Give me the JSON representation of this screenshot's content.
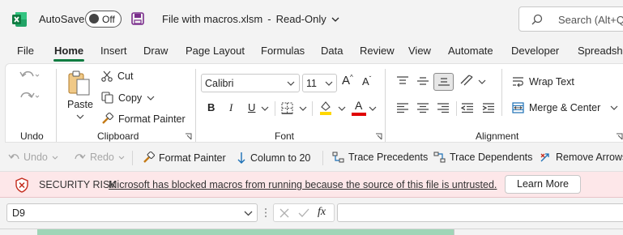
{
  "titlebar": {
    "autosave_label": "AutoSave",
    "autosave_state": "Off",
    "filename": "File with macros.xlsm",
    "separator": "-",
    "mode": "Read-Only",
    "search_placeholder": "Search (Alt+Q)"
  },
  "tabs": [
    "File",
    "Home",
    "Insert",
    "Draw",
    "Page Layout",
    "Formulas",
    "Data",
    "Review",
    "View",
    "Automate",
    "Developer",
    "Spreadsheet"
  ],
  "ribbon": {
    "undo_group": "Undo",
    "clipboard": {
      "paste": "Paste",
      "cut": "Cut",
      "copy": "Copy",
      "format_painter": "Format Painter",
      "group_label": "Clipboard"
    },
    "font": {
      "name": "Calibri",
      "size": "11",
      "grow": "A",
      "shrink": "A",
      "bold": "B",
      "italic": "I",
      "underline": "U",
      "font_color_letter": "A",
      "group_label": "Font",
      "highlight_color": "#ffd700",
      "font_color": "#e00000"
    },
    "alignment": {
      "wrap_text": "Wrap Text",
      "merge_center": "Merge & Center",
      "group_label": "Alignment"
    }
  },
  "qat": {
    "undo": "Undo",
    "redo": "Redo",
    "format_painter": "Format Painter",
    "column": "Column to 20",
    "trace_precedents": "Trace Precedents",
    "trace_dependents": "Trace Dependents",
    "remove_arrows": "Remove Arrows"
  },
  "security": {
    "title": "SECURITY RISK",
    "message": "Microsoft has blocked macros from running because the source of this file is untrusted.",
    "button": "Learn More"
  },
  "formula_bar": {
    "name_box": "D9",
    "fx": "fx",
    "value": ""
  },
  "colors": {
    "excel_green": "#107c41",
    "security_bg": "#fde7e9",
    "security_icon": "#c42b1c",
    "tab_underline": "#107c41",
    "selected_col": "#9fd5b7"
  }
}
